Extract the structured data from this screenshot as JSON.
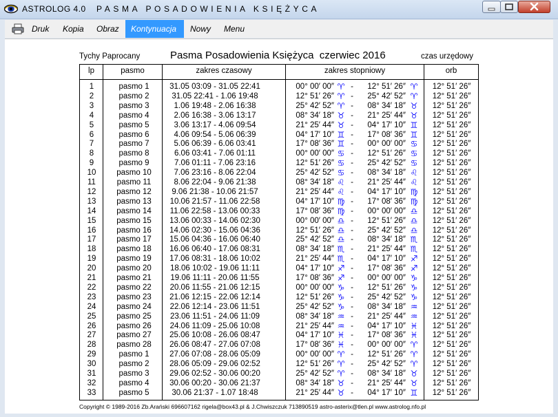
{
  "window": {
    "title": "ASTROLOG 4.0",
    "subtitle": "PASMA POSADOWIENIA KSIĘŻYCA",
    "colors": {
      "menu_active": "#3399ff",
      "sign_symbol": "#1414ff",
      "close_button": "#c2402b"
    }
  },
  "menu": {
    "print_icon": "printer-icon",
    "items": [
      {
        "label": "Druk"
      },
      {
        "label": "Kopia"
      },
      {
        "label": "Obraz"
      },
      {
        "label": "Kontynuacja",
        "active": true
      },
      {
        "label": "Nowy"
      },
      {
        "label": "Menu"
      }
    ]
  },
  "report": {
    "location": "Tychy Paprocany",
    "title": "Pasma Posadowienia Księżyca  czerwiec 2016",
    "time_mode": "czas urzędowy",
    "columns": {
      "lp": "lp",
      "pasmo": "pasmo",
      "time": "zakres czasowy",
      "degrees": "zakres stopniowy",
      "orb": "orb"
    },
    "rows": [
      {
        "lp": "1",
        "pasmo": "pasmo  1",
        "time": "31.05 03:09  - 31.05 22:41",
        "d1": "00° 00′ 00″",
        "s1": "♈",
        "d2": "12° 51′ 26″",
        "s2": "♈",
        "orb": "12° 51′ 26″"
      },
      {
        "lp": "2",
        "pasmo": "pasmo  2",
        "time": "31.05 22:41  -  1.06 19:48",
        "d1": "12° 51′ 26″",
        "s1": "♈",
        "d2": "25° 42′ 52″",
        "s2": "♈",
        "orb": "12° 51′ 26″"
      },
      {
        "lp": "3",
        "pasmo": "pasmo  3",
        "time": "1.06 19:48  -  2.06 16:38",
        "d1": "25° 42′ 52″",
        "s1": "♈",
        "d2": "08° 34′ 18″",
        "s2": "♉",
        "orb": "12° 51′ 26″"
      },
      {
        "lp": "4",
        "pasmo": "pasmo  4",
        "time": "2.06 16:38  -  3.06 13:17",
        "d1": "08° 34′ 18″",
        "s1": "♉",
        "d2": "21° 25′ 44″",
        "s2": "♉",
        "orb": "12° 51′ 26″"
      },
      {
        "lp": "5",
        "pasmo": "pasmo  5",
        "time": "3.06 13:17  -  4.06 09:54",
        "d1": "21° 25′ 44″",
        "s1": "♉",
        "d2": "04° 17′ 10″",
        "s2": "♊",
        "orb": "12° 51′ 26″"
      },
      {
        "lp": "6",
        "pasmo": "pasmo  6",
        "time": "4.06 09:54  -  5.06 06:39",
        "d1": "04° 17′ 10″",
        "s1": "♊",
        "d2": "17° 08′ 36″",
        "s2": "♊",
        "orb": "12° 51′ 26″"
      },
      {
        "lp": "7",
        "pasmo": "pasmo  7",
        "time": "5.06 06:39  -  6.06 03:41",
        "d1": "17° 08′ 36″",
        "s1": "♊",
        "d2": "00° 00′ 00″",
        "s2": "♋",
        "orb": "12° 51′ 26″"
      },
      {
        "lp": "8",
        "pasmo": "pasmo  8",
        "time": "6.06 03:41  -  7.06 01:11",
        "d1": "00° 00′ 00″",
        "s1": "♋",
        "d2": "12° 51′ 26″",
        "s2": "♋",
        "orb": "12° 51′ 26″"
      },
      {
        "lp": "9",
        "pasmo": "pasmo  9",
        "time": "7.06 01:11  -  7.06 23:16",
        "d1": "12° 51′ 26″",
        "s1": "♋",
        "d2": "25° 42′ 52″",
        "s2": "♋",
        "orb": "12° 51′ 26″"
      },
      {
        "lp": "10",
        "pasmo": "pasmo 10",
        "time": "7.06 23:16  -  8.06 22:04",
        "d1": "25° 42′ 52″",
        "s1": "♋",
        "d2": "08° 34′ 18″",
        "s2": "♌",
        "orb": "12° 51′ 26″"
      },
      {
        "lp": "11",
        "pasmo": "pasmo 11",
        "time": "8.06 22:04  -  9.06 21:38",
        "d1": "08° 34′ 18″",
        "s1": "♌",
        "d2": "21° 25′ 44″",
        "s2": "♌",
        "orb": "12° 51′ 26″"
      },
      {
        "lp": "12",
        "pasmo": "pasmo 12",
        "time": "9.06 21:38  - 10.06 21:57",
        "d1": "21° 25′ 44″",
        "s1": "♌",
        "d2": "04° 17′ 10″",
        "s2": "♍",
        "orb": "12° 51′ 26″"
      },
      {
        "lp": "13",
        "pasmo": "pasmo 13",
        "time": "10.06 21:57  - 11.06 22:58",
        "d1": "04° 17′ 10″",
        "s1": "♍",
        "d2": "17° 08′ 36″",
        "s2": "♍",
        "orb": "12° 51′ 26″"
      },
      {
        "lp": "14",
        "pasmo": "pasmo 14",
        "time": "11.06 22:58  - 13.06 00:33",
        "d1": "17° 08′ 36″",
        "s1": "♍",
        "d2": "00° 00′ 00″",
        "s2": "♎",
        "orb": "12° 51′ 26″"
      },
      {
        "lp": "15",
        "pasmo": "pasmo 15",
        "time": "13.06 00:33  - 14.06 02:30",
        "d1": "00° 00′ 00″",
        "s1": "♎",
        "d2": "12° 51′ 26″",
        "s2": "♎",
        "orb": "12° 51′ 26″"
      },
      {
        "lp": "16",
        "pasmo": "pasmo 16",
        "time": "14.06 02:30  - 15.06 04:36",
        "d1": "12° 51′ 26″",
        "s1": "♎",
        "d2": "25° 42′ 52″",
        "s2": "♎",
        "orb": "12° 51′ 26″"
      },
      {
        "lp": "17",
        "pasmo": "pasmo 17",
        "time": "15.06 04:36  - 16.06 06:40",
        "d1": "25° 42′ 52″",
        "s1": "♎",
        "d2": "08° 34′ 18″",
        "s2": "♏",
        "orb": "12° 51′ 26″"
      },
      {
        "lp": "18",
        "pasmo": "pasmo 18",
        "time": "16.06 06:40  - 17.06 08:31",
        "d1": "08° 34′ 18″",
        "s1": "♏",
        "d2": "21° 25′ 44″",
        "s2": "♏",
        "orb": "12° 51′ 26″"
      },
      {
        "lp": "19",
        "pasmo": "pasmo 19",
        "time": "17.06 08:31  - 18.06 10:02",
        "d1": "21° 25′ 44″",
        "s1": "♏",
        "d2": "04° 17′ 10″",
        "s2": "♐",
        "orb": "12° 51′ 26″"
      },
      {
        "lp": "20",
        "pasmo": "pasmo 20",
        "time": "18.06 10:02  - 19.06 11:11",
        "d1": "04° 17′ 10″",
        "s1": "♐",
        "d2": "17° 08′ 36″",
        "s2": "♐",
        "orb": "12° 51′ 26″"
      },
      {
        "lp": "21",
        "pasmo": "pasmo 21",
        "time": "19.06 11:11  - 20.06 11:55",
        "d1": "17° 08′ 36″",
        "s1": "♐",
        "d2": "00° 00′ 00″",
        "s2": "♑",
        "orb": "12° 51′ 26″"
      },
      {
        "lp": "22",
        "pasmo": "pasmo 22",
        "time": "20.06 11:55  - 21.06 12:15",
        "d1": "00° 00′ 00″",
        "s1": "♑",
        "d2": "12° 51′ 26″",
        "s2": "♑",
        "orb": "12° 51′ 26″"
      },
      {
        "lp": "23",
        "pasmo": "pasmo 23",
        "time": "21.06 12:15  - 22.06 12:14",
        "d1": "12° 51′ 26″",
        "s1": "♑",
        "d2": "25° 42′ 52″",
        "s2": "♑",
        "orb": "12° 51′ 26″"
      },
      {
        "lp": "24",
        "pasmo": "pasmo 24",
        "time": "22.06 12:14  - 23.06 11:51",
        "d1": "25° 42′ 52″",
        "s1": "♑",
        "d2": "08° 34′ 18″",
        "s2": "♒",
        "orb": "12° 51′ 26″"
      },
      {
        "lp": "25",
        "pasmo": "pasmo 25",
        "time": "23.06 11:51  - 24.06 11:09",
        "d1": "08° 34′ 18″",
        "s1": "♒",
        "d2": "21° 25′ 44″",
        "s2": "♒",
        "orb": "12° 51′ 26″"
      },
      {
        "lp": "26",
        "pasmo": "pasmo 26",
        "time": "24.06 11:09  - 25.06 10:08",
        "d1": "21° 25′ 44″",
        "s1": "♒",
        "d2": "04° 17′ 10″",
        "s2": "♓",
        "orb": "12° 51′ 26″"
      },
      {
        "lp": "27",
        "pasmo": "pasmo 27",
        "time": "25.06 10:08  - 26.06 08:47",
        "d1": "04° 17′ 10″",
        "s1": "♓",
        "d2": "17° 08′ 36″",
        "s2": "♓",
        "orb": "12° 51′ 26″"
      },
      {
        "lp": "28",
        "pasmo": "pasmo 28",
        "time": "26.06 08:47  - 27.06 07:08",
        "d1": "17° 08′ 36″",
        "s1": "♓",
        "d2": "00° 00′ 00″",
        "s2": "♈",
        "orb": "12° 51′ 26″"
      },
      {
        "lp": "29",
        "pasmo": "pasmo  1",
        "time": "27.06 07:08  - 28.06 05:09",
        "d1": "00° 00′ 00″",
        "s1": "♈",
        "d2": "12° 51′ 26″",
        "s2": "♈",
        "orb": "12° 51′ 26″"
      },
      {
        "lp": "30",
        "pasmo": "pasmo  2",
        "time": "28.06 05:09  - 29.06 02:52",
        "d1": "12° 51′ 26″",
        "s1": "♈",
        "d2": "25° 42′ 52″",
        "s2": "♈",
        "orb": "12° 51′ 26″"
      },
      {
        "lp": "31",
        "pasmo": "pasmo  3",
        "time": "29.06 02:52  - 30.06 00:20",
        "d1": "25° 42′ 52″",
        "s1": "♈",
        "d2": "08° 34′ 18″",
        "s2": "♉",
        "orb": "12° 51′ 26″"
      },
      {
        "lp": "32",
        "pasmo": "pasmo  4",
        "time": "30.06 00:20  - 30.06 21:37",
        "d1": "08° 34′ 18″",
        "s1": "♉",
        "d2": "21° 25′ 44″",
        "s2": "♉",
        "orb": "12° 51′ 26″"
      },
      {
        "lp": "33",
        "pasmo": "pasmo  5",
        "time": "30.06 21:37  -  1.07 18:48",
        "d1": "21° 25′ 44″",
        "s1": "♉",
        "d2": "04° 17′ 10″",
        "s2": "♊",
        "orb": "12° 51′ 26″"
      }
    ],
    "footer": "Copyright © 1989-2016 Zb.Arański 696607162 rigela@box43.pl & J.Chwiszczuk 713890519 astro-asterix@tlen.pl www.astrolog.nfo.pl"
  }
}
